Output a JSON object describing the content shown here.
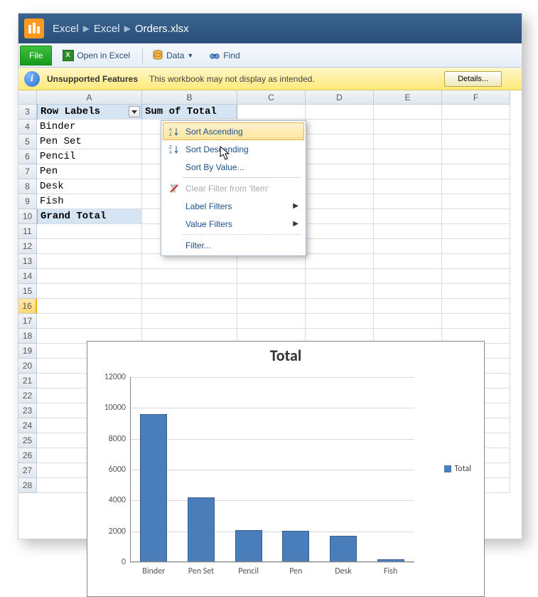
{
  "breadcrumb": {
    "seg1": "Excel",
    "seg2": "Excel",
    "seg3": "Orders.xlsx"
  },
  "toolbar": {
    "file": "File",
    "open_excel": "Open in Excel",
    "data": "Data",
    "find": "Find"
  },
  "msgbar": {
    "title": "Unsupported Features",
    "text": "This workbook may not display as intended.",
    "details": "Details..."
  },
  "columns": [
    "A",
    "B",
    "C",
    "D",
    "E",
    "F"
  ],
  "rows_start": 3,
  "rows_count": 10,
  "pivot": {
    "row_labels_hdr": "Row Labels",
    "sum_hdr": "Sum of Total",
    "items": [
      "Binder",
      "Pen Set",
      "Pencil",
      "Pen",
      "Desk",
      "Fish"
    ],
    "grand_total": "Grand Total"
  },
  "menu": {
    "sort_asc": "Sort Ascending",
    "sort_desc": "Sort Descending",
    "sort_by_value": "Sort By Value...",
    "clear_filter": "Clear Filter from 'Item'",
    "label_filters": "Label Filters",
    "value_filters": "Value Filters",
    "filter": "Filter..."
  },
  "chart_data": {
    "type": "bar",
    "title": "Total",
    "legend": "Total",
    "ylim": [
      0,
      12000
    ],
    "ystep": 2000,
    "categories": [
      "Binder",
      "Pen Set",
      "Pencil",
      "Pen",
      "Desk",
      "Fish"
    ],
    "values": [
      9600,
      4200,
      2100,
      2050,
      1700,
      200
    ]
  }
}
